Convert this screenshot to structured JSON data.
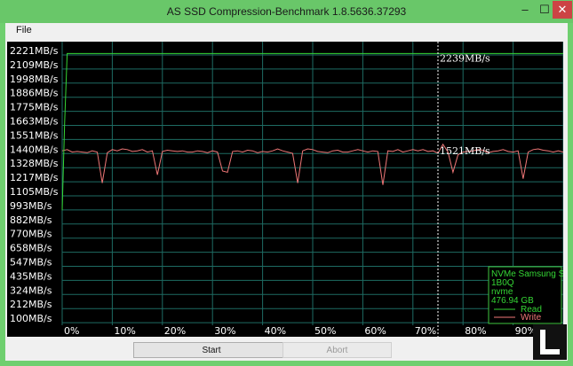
{
  "window": {
    "title": "AS SSD Compression-Benchmark 1.8.5636.37293",
    "minimize_glyph": "–",
    "maximize_glyph": "☐",
    "close_glyph": "✕"
  },
  "menu": {
    "file_label": "File"
  },
  "buttons": {
    "start_label": "Start",
    "abort_label": "Abort"
  },
  "colors": {
    "plot_background": "#000000",
    "grid": "#1e6b63",
    "read": "#35d635",
    "write": "#f07777",
    "cursor": "#ffffff",
    "legend_border": "#3fc63f"
  },
  "chart_data": {
    "type": "line",
    "ylabels": [
      "2221MB/s",
      "2109MB/s",
      "1998MB/s",
      "1886MB/s",
      "1775MB/s",
      "1663MB/s",
      "1551MB/s",
      "1440MB/s",
      "1328MB/s",
      "1217MB/s",
      "1105MB/s",
      "993MB/s",
      "882MB/s",
      "770MB/s",
      "658MB/s",
      "547MB/s",
      "435MB/s",
      "324MB/s",
      "212MB/s",
      "100MB/s"
    ],
    "xlabels": [
      "0%",
      "10%",
      "20%",
      "30%",
      "40%",
      "50%",
      "60%",
      "70%",
      "80%",
      "90%"
    ],
    "xlim": [
      0,
      100
    ],
    "ylim": [
      0,
      2333
    ],
    "grid": true,
    "series": [
      {
        "name": "Read",
        "x": [
          0,
          0.5,
          1,
          100
        ],
        "y": [
          1000,
          1700,
          2239,
          2239
        ]
      },
      {
        "name": "Write",
        "x": [
          0,
          1,
          2,
          3,
          4,
          5,
          6,
          7,
          8,
          9,
          10,
          11,
          12,
          13,
          14,
          15,
          16,
          17,
          18,
          19,
          20,
          21,
          22,
          23,
          24,
          25,
          26,
          27,
          28,
          29,
          30,
          31,
          32,
          33,
          34,
          35,
          36,
          37,
          38,
          39,
          40,
          41,
          42,
          43,
          44,
          45,
          46,
          47,
          48,
          49,
          50,
          51,
          52,
          53,
          54,
          55,
          56,
          57,
          58,
          59,
          60,
          61,
          62,
          63,
          64,
          65,
          66,
          67,
          68,
          69,
          70,
          71,
          72,
          73,
          74,
          75,
          76,
          77,
          78,
          79,
          80,
          81,
          82,
          83,
          84,
          85,
          86,
          87,
          88,
          89,
          90,
          91,
          92,
          93,
          94,
          95,
          96,
          97,
          98,
          99,
          100
        ],
        "y": [
          1470,
          1480,
          1460,
          1465,
          1460,
          1455,
          1470,
          1460,
          1215,
          1455,
          1480,
          1470,
          1485,
          1480,
          1465,
          1470,
          1480,
          1460,
          1470,
          1280,
          1465,
          1475,
          1470,
          1465,
          1470,
          1460,
          1460,
          1470,
          1465,
          1455,
          1470,
          1460,
          1310,
          1300,
          1465,
          1470,
          1460,
          1475,
          1470,
          1455,
          1465,
          1460,
          1470,
          1485,
          1470,
          1460,
          1450,
          1215,
          1470,
          1485,
          1480,
          1465,
          1460,
          1455,
          1470,
          1475,
          1460,
          1460,
          1470,
          1480,
          1470,
          1460,
          1470,
          1465,
          1200,
          1470,
          1465,
          1480,
          1460,
          1470,
          1480,
          1470,
          1480,
          1465,
          1470,
          1450,
          1521,
          1460,
          1300,
          1440,
          1460,
          1465,
          1470,
          1480,
          1475,
          1455,
          1465,
          1470,
          1480,
          1465,
          1460,
          1470,
          1250,
          1460,
          1480,
          1485,
          1475,
          1470,
          1460,
          1470,
          1460
        ]
      }
    ],
    "cursor": {
      "x": 75,
      "read_label": "2239MB/s",
      "write_label": "1521MB/s"
    },
    "legend": {
      "position": "bottom-right",
      "lines": [
        "NVMe Samsung SS",
        "1B0Q",
        "nvme",
        "476.94 GB"
      ],
      "read_label": "Read",
      "write_label": "Write"
    }
  }
}
